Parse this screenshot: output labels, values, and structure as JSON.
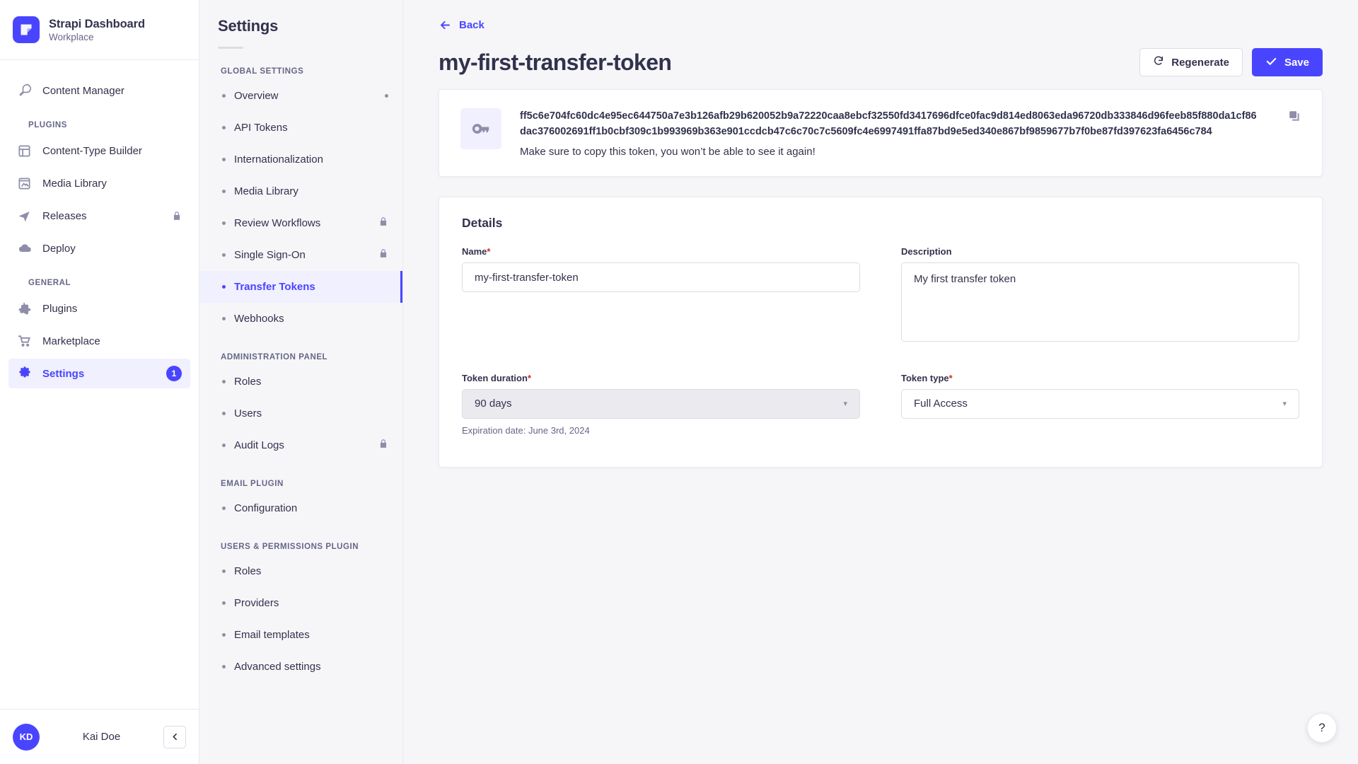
{
  "brand": {
    "title": "Strapi Dashboard",
    "subtitle": "Workplace",
    "logo_color": "#4945ff"
  },
  "main_nav": {
    "top_items": [
      {
        "label": "Content Manager",
        "icon": "feather-icon"
      }
    ],
    "sections": [
      {
        "label": "PLUGINS",
        "items": [
          {
            "label": "Content-Type Builder",
            "icon": "layout-icon",
            "locked": false
          },
          {
            "label": "Media Library",
            "icon": "image-icon",
            "locked": false
          },
          {
            "label": "Releases",
            "icon": "paper-plane-icon",
            "locked": true
          },
          {
            "label": "Deploy",
            "icon": "cloud-icon",
            "locked": false
          }
        ]
      },
      {
        "label": "GENERAL",
        "items": [
          {
            "label": "Plugins",
            "icon": "puzzle-icon",
            "locked": false
          },
          {
            "label": "Marketplace",
            "icon": "shopping-cart-icon",
            "locked": false
          },
          {
            "label": "Settings",
            "icon": "gear-icon",
            "locked": false,
            "active": true,
            "badge": "1"
          }
        ]
      }
    ]
  },
  "user": {
    "initials": "KD",
    "name": "Kai Doe"
  },
  "settings_nav": {
    "title": "Settings",
    "groups": [
      {
        "label": "GLOBAL SETTINGS",
        "items": [
          {
            "label": "Overview",
            "trailing": "dot"
          },
          {
            "label": "API Tokens"
          },
          {
            "label": "Internationalization"
          },
          {
            "label": "Media Library"
          },
          {
            "label": "Review Workflows",
            "trailing": "lock"
          },
          {
            "label": "Single Sign-On",
            "trailing": "lock"
          },
          {
            "label": "Transfer Tokens",
            "active": true
          },
          {
            "label": "Webhooks"
          }
        ]
      },
      {
        "label": "ADMINISTRATION PANEL",
        "items": [
          {
            "label": "Roles"
          },
          {
            "label": "Users"
          },
          {
            "label": "Audit Logs",
            "trailing": "lock"
          }
        ]
      },
      {
        "label": "EMAIL PLUGIN",
        "items": [
          {
            "label": "Configuration"
          }
        ]
      },
      {
        "label": "USERS & PERMISSIONS PLUGIN",
        "items": [
          {
            "label": "Roles"
          },
          {
            "label": "Providers"
          },
          {
            "label": "Email templates"
          },
          {
            "label": "Advanced settings"
          }
        ]
      }
    ]
  },
  "header": {
    "back_label": "Back",
    "page_title": "my-first-transfer-token",
    "regenerate_label": "Regenerate",
    "save_label": "Save",
    "accent_color": "#4945ff"
  },
  "token_banner": {
    "token": "ff5c6e704fc60dc4e95ec644750a7e3b126afb29b620052b9a72220caa8ebcf32550fd3417696dfce0fac9d814ed8063eda96720db333846d96feeb85f880da1cf86dac376002691ff1b0cbf309c1b993969b363e901ccdcb47c6c70c7c5609fc4e6997491ffa87bd9e5ed340e867bf9859677b7f0be87fd397623fa6456c784",
    "warning": "Make sure to copy this token, you won’t be able to see it again!"
  },
  "details": {
    "heading": "Details",
    "name": {
      "label": "Name",
      "required": true,
      "value": "my-first-transfer-token"
    },
    "description": {
      "label": "Description",
      "required": false,
      "value": "My first transfer token"
    },
    "token_duration": {
      "label": "Token duration",
      "required": true,
      "value": "90 days",
      "disabled": true,
      "hint": "Expiration date: June 3rd, 2024"
    },
    "token_type": {
      "label": "Token type",
      "required": true,
      "value": "Full Access"
    }
  },
  "help": {
    "label": "?"
  }
}
